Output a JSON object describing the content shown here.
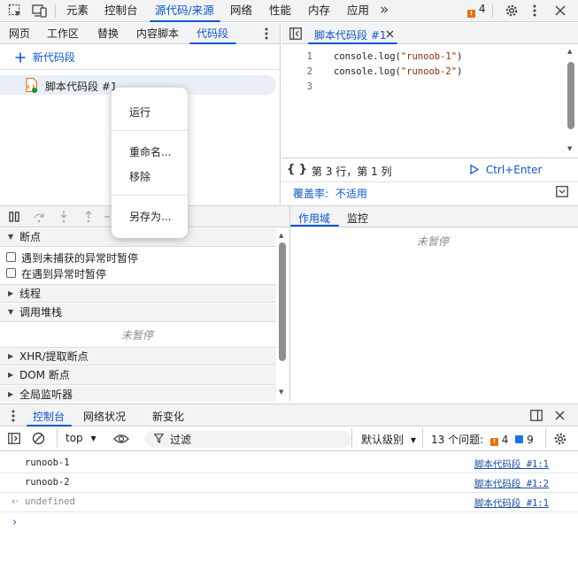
{
  "top_tabs": {
    "elements": "元素",
    "console": "控制台",
    "sources": "源代码/来源",
    "network": "网络",
    "performance": "性能",
    "memory": "内存",
    "application": "应用",
    "more": "»",
    "issues_count": "4"
  },
  "sources_nav": {
    "page": "网页",
    "workspace": "工作区",
    "overrides": "替换",
    "content_scripts": "内容脚本",
    "snippets": "代码段"
  },
  "snippets": {
    "new_snippet": "新代码段",
    "items": [
      {
        "name": "脚本代码段 #1"
      }
    ]
  },
  "editor": {
    "tab_title": "脚本代码段 #1",
    "lines": [
      {
        "num": "1",
        "pre": "console.log(",
        "str": "\"runoob-1\"",
        "post": ")"
      },
      {
        "num": "2",
        "pre": "console.log(",
        "str": "\"runoob-2\"",
        "post": ")"
      },
      {
        "num": "3",
        "pre": "",
        "str": "",
        "post": ""
      }
    ],
    "position": "第 3 行，第 1 列",
    "run_shortcut": "Ctrl+Enter",
    "coverage_label": "覆盖率:",
    "coverage_value": "不适用"
  },
  "context_menu": {
    "run": "运行",
    "rename": "重命名...",
    "remove": "移除",
    "save_as": "另存为..."
  },
  "debugger": {
    "breakpoints": "断点",
    "pause_uncaught": "遇到未捕获的异常时暂停",
    "pause_caught": "在遇到异常时暂停",
    "threads": "线程",
    "call_stack": "调用堆栈",
    "not_paused": "未暂停",
    "xhr_breakpoints": "XHR/提取断点",
    "dom_breakpoints": "DOM 断点",
    "global_listeners": "全局监听器"
  },
  "scope_panel": {
    "scope": "作用域",
    "watch": "监控",
    "not_paused": "未暂停"
  },
  "drawer": {
    "console": "控制台",
    "network_conditions": "网络状况",
    "whats_new": "新变化"
  },
  "console_toolbar": {
    "context": "top",
    "filter_placeholder": "过滤",
    "levels": "默认级别",
    "issues_label": "13 个问题:",
    "issues_orange": "4",
    "issues_blue": "9"
  },
  "console_rows": [
    {
      "text": "runoob-1",
      "source": "脚本代码段 #1:1"
    },
    {
      "text": "runoob-2",
      "source": "脚本代码段 #1:2"
    },
    {
      "text": "undefined",
      "source": "脚本代码段 #1:1"
    }
  ],
  "colors": {
    "accent": "#0b57d0",
    "toolbar_bg": "#f1f3f4",
    "issue_orange": "#e8710a",
    "string": "#8e2d0f"
  }
}
